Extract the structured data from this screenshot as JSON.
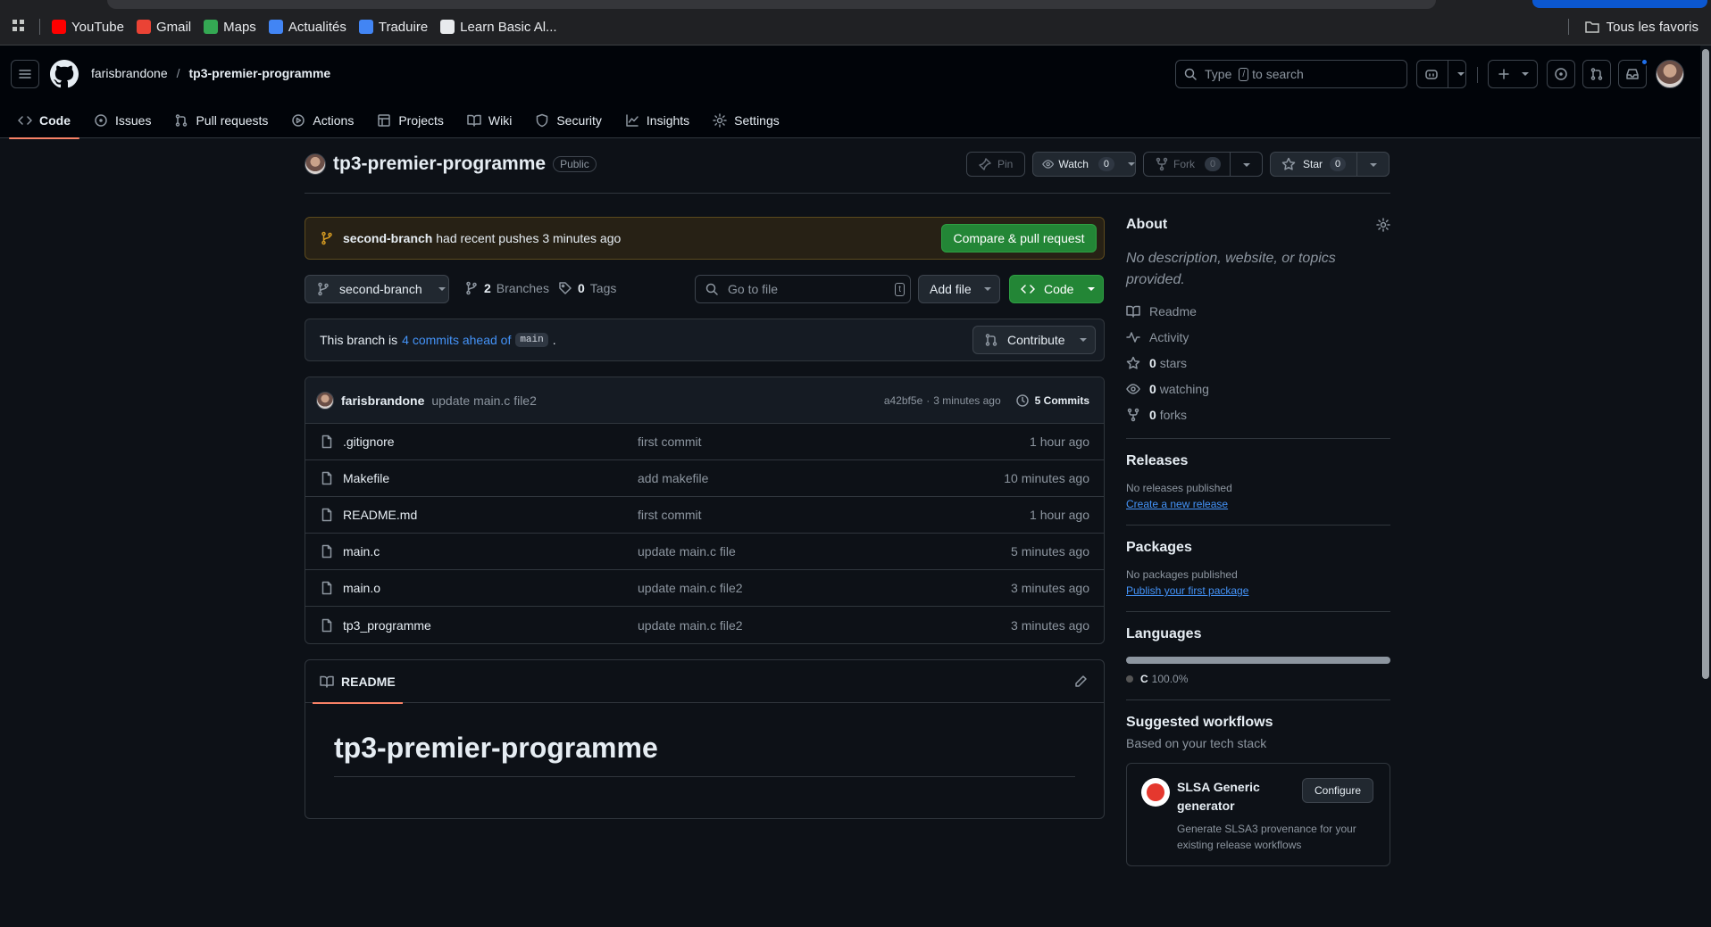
{
  "browser": {
    "bookmarks": [
      {
        "label": "YouTube",
        "icon": "youtube-icon",
        "color": "#ff0000"
      },
      {
        "label": "Gmail",
        "icon": "gmail-icon",
        "color": "#ea4335"
      },
      {
        "label": "Maps",
        "icon": "maps-icon",
        "color": "#34a853"
      },
      {
        "label": "Actualités",
        "icon": "news-icon",
        "color": "#4285f4"
      },
      {
        "label": "Traduire",
        "icon": "translate-icon",
        "color": "#4285f4"
      },
      {
        "label": "Learn Basic Al...",
        "icon": "learn-icon",
        "color": "#e8eaed"
      }
    ],
    "all_bookmarks": "Tous les favoris"
  },
  "header": {
    "owner": "farisbrandone",
    "separator": "/",
    "repo": "tp3-premier-programme",
    "search_placeholder_pre": "Type",
    "search_key": "/",
    "search_placeholder_post": "to search"
  },
  "tabs": [
    {
      "label": "Code",
      "icon": "code-icon",
      "selected": true
    },
    {
      "label": "Issues",
      "icon": "issue-icon"
    },
    {
      "label": "Pull requests",
      "icon": "pull-request-icon"
    },
    {
      "label": "Actions",
      "icon": "play-icon"
    },
    {
      "label": "Projects",
      "icon": "table-icon"
    },
    {
      "label": "Wiki",
      "icon": "book-icon"
    },
    {
      "label": "Security",
      "icon": "shield-icon"
    },
    {
      "label": "Insights",
      "icon": "graph-icon"
    },
    {
      "label": "Settings",
      "icon": "gear-icon"
    }
  ],
  "repo": {
    "name": "tp3-premier-programme",
    "visibility": "Public",
    "pin": "Pin",
    "watch": "Watch",
    "watch_count": "0",
    "fork": "Fork",
    "fork_count": "0",
    "star": "Star",
    "star_count": "0"
  },
  "banner": {
    "branch": "second-branch",
    "text": "had recent pushes 3 minutes ago",
    "button": "Compare & pull request"
  },
  "toolbar": {
    "branch": "second-branch",
    "branches_count": "2",
    "branches_label": "Branches",
    "tags_count": "0",
    "tags_label": "Tags",
    "goto_placeholder": "Go to file",
    "goto_key": "t",
    "add_file": "Add file",
    "code": "Code"
  },
  "ahead": {
    "pre": "This branch is",
    "link": "4 commits ahead of",
    "branch": "main",
    "post": ".",
    "contribute": "Contribute"
  },
  "commit": {
    "author": "farisbrandone",
    "message": "update main.c file2",
    "sha": "a42bf5e",
    "sep": "·",
    "time": "3 minutes ago",
    "commits": "5 Commits"
  },
  "files": [
    {
      "name": ".gitignore",
      "message": "first commit",
      "date": "1 hour ago"
    },
    {
      "name": "Makefile",
      "message": "add makefile",
      "date": "10 minutes ago"
    },
    {
      "name": "README.md",
      "message": "first commit",
      "date": "1 hour ago"
    },
    {
      "name": "main.c",
      "message": "update main.c file",
      "date": "5 minutes ago"
    },
    {
      "name": "main.o",
      "message": "update main.c file2",
      "date": "3 minutes ago"
    },
    {
      "name": "tp3_programme",
      "message": "update main.c file2",
      "date": "3 minutes ago"
    }
  ],
  "readme": {
    "tab": "README",
    "title": "tp3-premier-programme"
  },
  "sidebar": {
    "about": "About",
    "description": "No description, website, or topics provided.",
    "links": [
      {
        "icon": "book-icon",
        "label": "Readme"
      },
      {
        "icon": "pulse-icon",
        "label": "Activity"
      },
      {
        "icon": "star-icon",
        "count": "0",
        "label": "stars"
      },
      {
        "icon": "eye-icon",
        "count": "0",
        "label": "watching"
      },
      {
        "icon": "fork-icon",
        "count": "0",
        "label": "forks"
      }
    ],
    "releases": "Releases",
    "releases_none": "No releases published",
    "releases_link": "Create a new release",
    "packages": "Packages",
    "packages_none": "No packages published",
    "packages_link": "Publish your first package",
    "languages": "Languages",
    "language": "C",
    "language_pct": "100.0%",
    "language_share": 1.0,
    "language_color": "#555555",
    "workflows": "Suggested workflows",
    "workflows_sub": "Based on your tech stack",
    "workflow_title": "SLSA Generic generator",
    "workflow_desc": "Generate SLSA3 provenance for your existing release workflows",
    "workflow_button": "Configure"
  },
  "colors": {
    "accent": "#f78166",
    "green": "#238636",
    "link": "#4493f8"
  }
}
